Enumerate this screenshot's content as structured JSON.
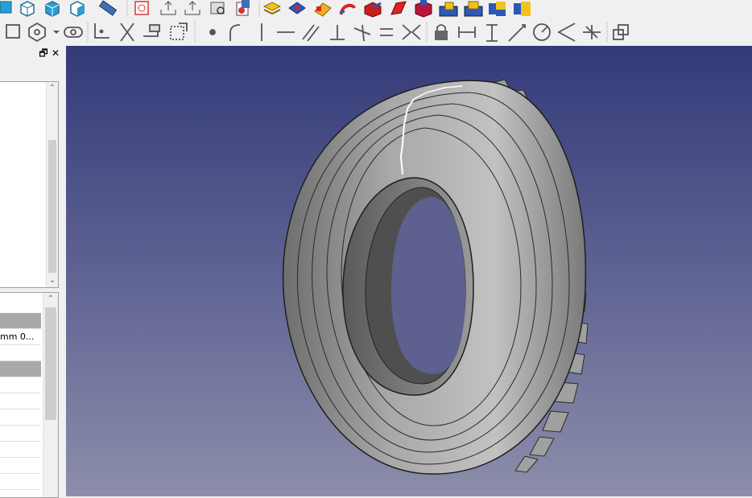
{
  "toolbar_top": {
    "icons": [
      "view-front-icon",
      "view-top-icon",
      "view-right-icon",
      "measure-icon",
      "sketch-icon",
      "export-icon",
      "import-icon",
      "inspect-icon",
      "refine-icon",
      "layers-icon",
      "box-icon",
      "cylinder-icon",
      "tube-icon",
      "pocket-icon",
      "solid-icon",
      "part-icon",
      "fuse-icon",
      "cut-icon",
      "common-icon"
    ]
  },
  "toolbar_sketch": {
    "icons": [
      "sketch-rect-icon",
      "polygon-icon",
      "slot-icon",
      "fillet-icon",
      "trim-icon",
      "extend-icon",
      "external-icon",
      "point-constraint-icon",
      "tangent-icon",
      "vertical-icon",
      "horizontal-icon",
      "parallel-icon",
      "perpendicular-icon",
      "tangent-constraint-icon",
      "equal-icon",
      "symmetric-icon",
      "lock-icon",
      "horiz-distance-icon",
      "vert-distance-icon",
      "distance-icon",
      "radius-icon",
      "angle-icon",
      "snell-icon",
      "toggle-construction-icon"
    ]
  },
  "panel": {
    "restore_glyph": "🗗",
    "close_glyph": "✕"
  },
  "properties": {
    "rows": [
      {
        "type": "group",
        "text": ""
      },
      {
        "type": "value",
        "text": "mm  0..."
      },
      {
        "type": "value",
        "text": ""
      },
      {
        "type": "group",
        "text": ""
      },
      {
        "type": "value",
        "text": ""
      },
      {
        "type": "value",
        "text": ""
      },
      {
        "type": "value",
        "text": ""
      },
      {
        "type": "value",
        "text": ""
      },
      {
        "type": "value",
        "text": ""
      },
      {
        "type": "value",
        "text": ""
      }
    ]
  },
  "colors": {
    "viewport_top": "#333a78",
    "viewport_bottom": "#8c8eaa",
    "tire": "#9a9a9a",
    "selection_edge": "#ffffff"
  }
}
